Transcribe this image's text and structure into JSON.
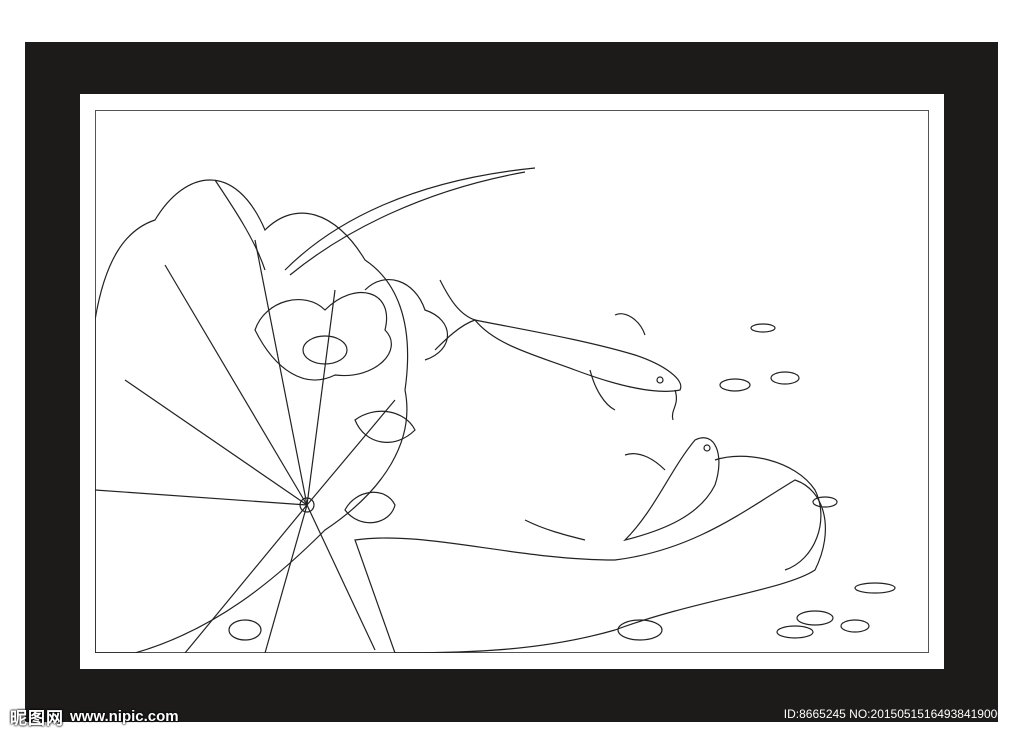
{
  "image": {
    "subject": "line-art lotus leaves, lotus flowers and two koi fish",
    "colors": {
      "frame": "#1d1a1a",
      "mat": "#ffffff",
      "line": "#222222"
    }
  },
  "watermark": {
    "logo_text": "昵图网",
    "url": "www.nipic.com",
    "id_text": "ID:8665245 NO:20150515164938419000"
  }
}
